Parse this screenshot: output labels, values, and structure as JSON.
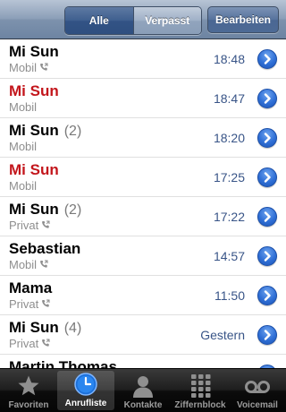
{
  "navbar": {
    "segments": [
      {
        "label": "Alle",
        "selected": true
      },
      {
        "label": "Verpasst",
        "selected": false
      }
    ],
    "edit_label": "Bearbeiten"
  },
  "colors": {
    "missed_call": "#c3161c",
    "time_text": "#385487",
    "disclosure_blue": "#2f6fd6"
  },
  "calls": [
    {
      "name": "Mi Sun",
      "count": "",
      "type": "Mobil",
      "outgoing_icon": true,
      "missed": false,
      "time": "18:48"
    },
    {
      "name": "Mi Sun",
      "count": "",
      "type": "Mobil",
      "outgoing_icon": false,
      "missed": true,
      "time": "18:47"
    },
    {
      "name": "Mi Sun",
      "count": "(2)",
      "type": "Mobil",
      "outgoing_icon": false,
      "missed": false,
      "time": "18:20"
    },
    {
      "name": "Mi Sun",
      "count": "",
      "type": "Mobil",
      "outgoing_icon": false,
      "missed": true,
      "time": "17:25"
    },
    {
      "name": "Mi Sun",
      "count": "(2)",
      "type": "Privat",
      "outgoing_icon": true,
      "missed": false,
      "time": "17:22"
    },
    {
      "name": "Sebastian",
      "count": "",
      "type": "Mobil",
      "outgoing_icon": true,
      "missed": false,
      "time": "14:57"
    },
    {
      "name": "Mama",
      "count": "",
      "type": "Privat",
      "outgoing_icon": true,
      "missed": false,
      "time": "11:50"
    },
    {
      "name": "Mi Sun",
      "count": "(4)",
      "type": "Privat",
      "outgoing_icon": true,
      "missed": false,
      "time": "Gestern"
    },
    {
      "name": "Martin Thomas",
      "count": "",
      "type": "",
      "outgoing_icon": false,
      "missed": false,
      "time": ""
    }
  ],
  "tabbar": {
    "tabs": [
      {
        "label": "Favoriten",
        "icon": "star-icon",
        "active": false
      },
      {
        "label": "Anrufliste",
        "icon": "clock-icon",
        "active": true
      },
      {
        "label": "Kontakte",
        "icon": "person-icon",
        "active": false
      },
      {
        "label": "Ziffernblock",
        "icon": "keypad-icon",
        "active": false
      },
      {
        "label": "Voicemail",
        "icon": "voicemail-icon",
        "active": false
      }
    ]
  }
}
